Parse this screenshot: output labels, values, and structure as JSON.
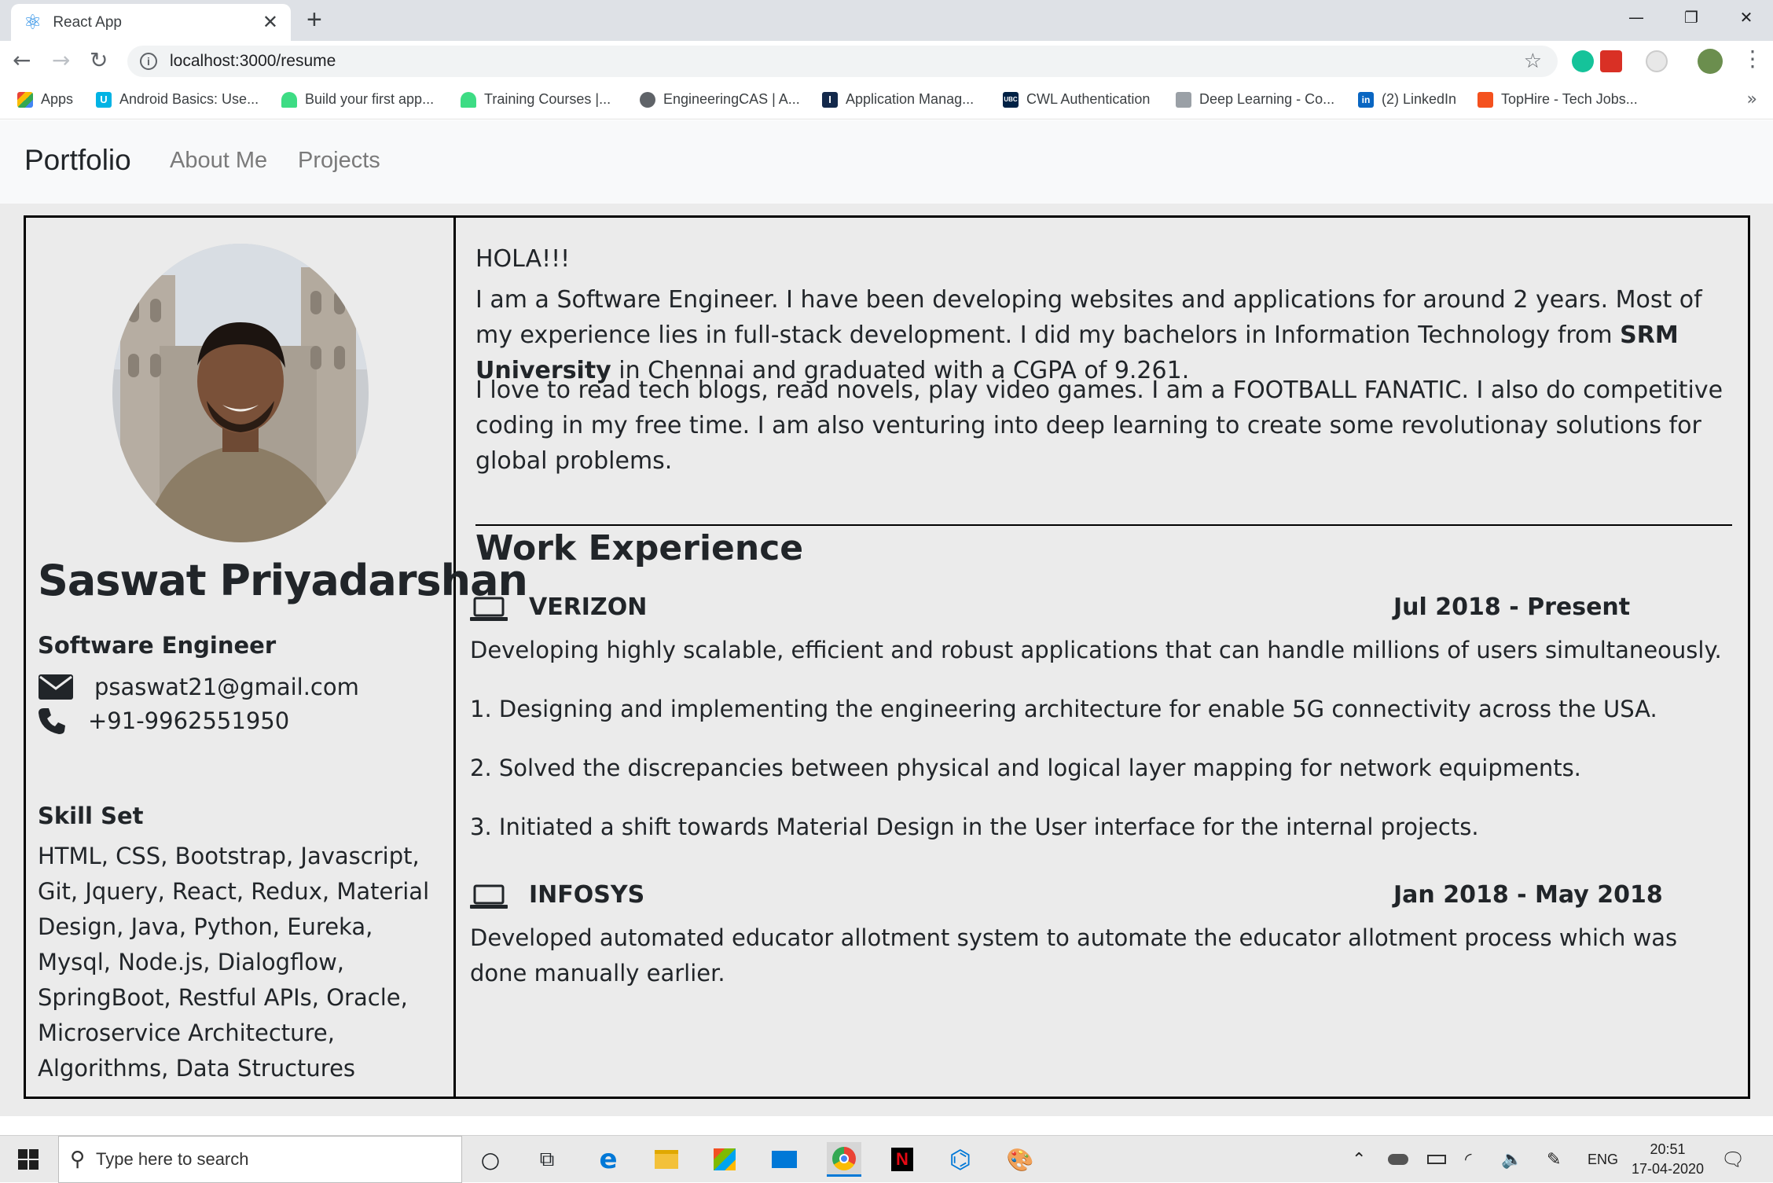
{
  "browser": {
    "tab_title": "React App",
    "url": "localhost:3000/resume",
    "bookmarks": [
      {
        "label": "Apps",
        "icon": "apps-grid-icon"
      },
      {
        "label": "Android Basics: Use...",
        "icon": "udacity-icon"
      },
      {
        "label": "Build your first app...",
        "icon": "android-icon"
      },
      {
        "label": "Training Courses |...",
        "icon": "android-icon"
      },
      {
        "label": "EngineeringCAS | A...",
        "icon": "globe-icon"
      },
      {
        "label": "Application Manag...",
        "icon": "illinois-icon"
      },
      {
        "label": "CWL Authentication",
        "icon": "ubc-icon"
      },
      {
        "label": "Deep Learning - Co...",
        "icon": "coursera-icon"
      },
      {
        "label": "(2) LinkedIn",
        "icon": "linkedin-icon"
      },
      {
        "label": "TopHire - Tech Jobs...",
        "icon": "tophire-icon"
      }
    ]
  },
  "navbar": {
    "brand": "Portfolio",
    "links": [
      "About Me",
      "Projects"
    ]
  },
  "profile": {
    "name": "Saswat Priyadarshan",
    "role": "Software Engineer",
    "email": "psaswat21@gmail.com",
    "phone": "+91-9962551950",
    "skills_heading": "Skill Set",
    "skills": "HTML, CSS, Bootstrap, Javascript, Git, Jquery, React, Redux, Material Design, Java, Python, Eureka, Mysql, Node.js, Dialogflow, SpringBoot, Restful APIs, Oracle, Microservice Architecture, Algorithms, Data Structures"
  },
  "about": {
    "greeting": "HOLA!!!",
    "p1_before": "I am a Software Engineer. I have been developing websites and applications for around 2 years. Most of my experience lies in full-stack development. I did my bachelors in Information Technology from ",
    "p1_bold": "SRM University",
    "p1_after": " in Chennai and graduated with a CGPA of 9.261.",
    "p2": "I love to read tech blogs, read novels, play video games. I am a FOOTBALL FANATIC. I also do competitive coding in my free time. I am also venturing into deep learning to create some revolutionay solutions for global problems."
  },
  "work": {
    "heading": "Work Experience",
    "jobs": [
      {
        "company": "VERIZON",
        "dates": "Jul 2018 - Present",
        "summary": "Developing highly scalable, efficient and robust applications that can handle millions of users simultaneously.",
        "points": [
          "1. Designing and implementing the engineering architecture for enable 5G connectivity across the USA.",
          "2. Solved the discrepancies between physical and logical layer mapping for network equipments.",
          "3. Initiated a shift towards Material Design in the User interface for the internal projects."
        ]
      },
      {
        "company": "INFOSYS",
        "dates": "Jan 2018 - May 2018",
        "summary": "Developed automated educator allotment system to automate the educator allotment process which was done manually earlier."
      }
    ]
  },
  "taskbar": {
    "search_placeholder": "Type here to search",
    "language": "ENG",
    "time": "20:51",
    "date": "17-04-2020"
  }
}
